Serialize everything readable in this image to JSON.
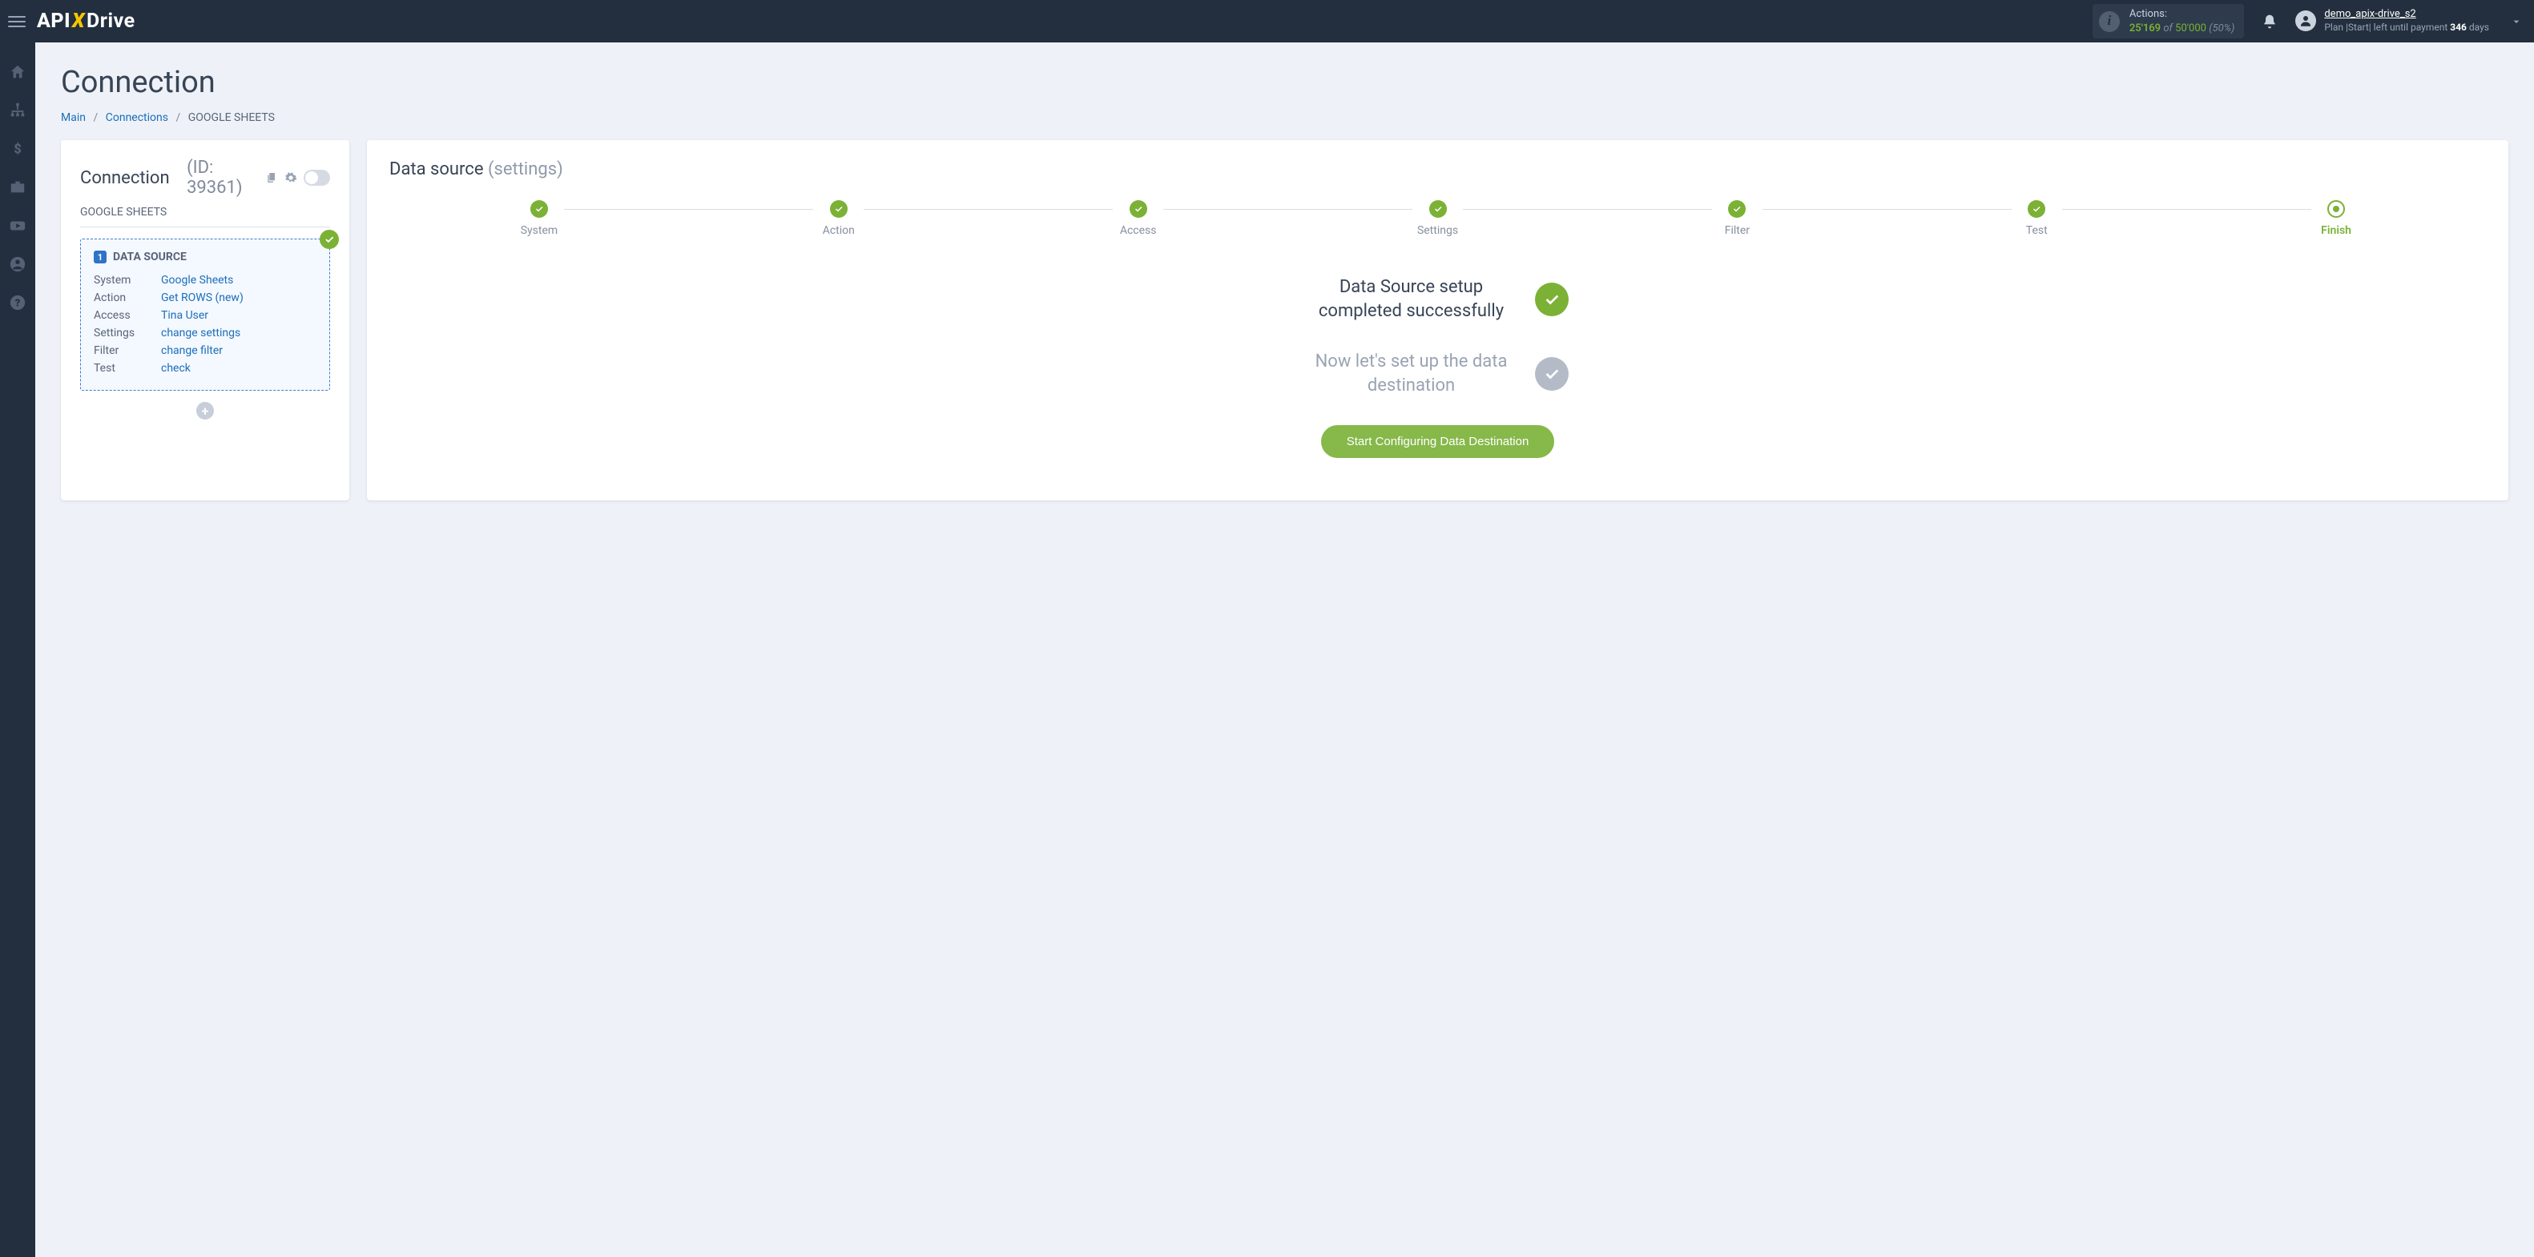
{
  "topbar": {
    "actions_label": "Actions:",
    "actions_used": "25'169",
    "actions_of": "of",
    "actions_total": "50'000",
    "actions_pct": "(50%)",
    "username": "demo_apix-drive_s2",
    "plan_prefix": "Plan |Start| left until payment ",
    "plan_days": "346",
    "plan_suffix": " days",
    "logo_api": "API",
    "logo_x": "X",
    "logo_drive": "Drive"
  },
  "page": {
    "title": "Connection",
    "crumb_main": "Main",
    "crumb_connections": "Connections",
    "crumb_current": "GOOGLE SHEETS"
  },
  "left": {
    "heading": "Connection",
    "id_label": "(ID: 39361)",
    "subtitle": "GOOGLE SHEETS",
    "box_title": "DATA SOURCE",
    "box_num": "1",
    "rows": {
      "system_k": "System",
      "system_v": "Google Sheets",
      "action_k": "Action",
      "action_v": "Get ROWS (new)",
      "access_k": "Access",
      "access_v": "Tina User",
      "settings_k": "Settings",
      "settings_v": "change settings",
      "filter_k": "Filter",
      "filter_v": "change filter",
      "test_k": "Test",
      "test_v": "check"
    }
  },
  "right": {
    "heading": "Data source",
    "heading_muted": "(settings)",
    "steps": [
      "System",
      "Action",
      "Access",
      "Settings",
      "Filter",
      "Test",
      "Finish"
    ],
    "msg1": "Data Source setup completed successfully",
    "msg2": "Now let's set up the data destination",
    "button": "Start Configuring Data Destination"
  }
}
